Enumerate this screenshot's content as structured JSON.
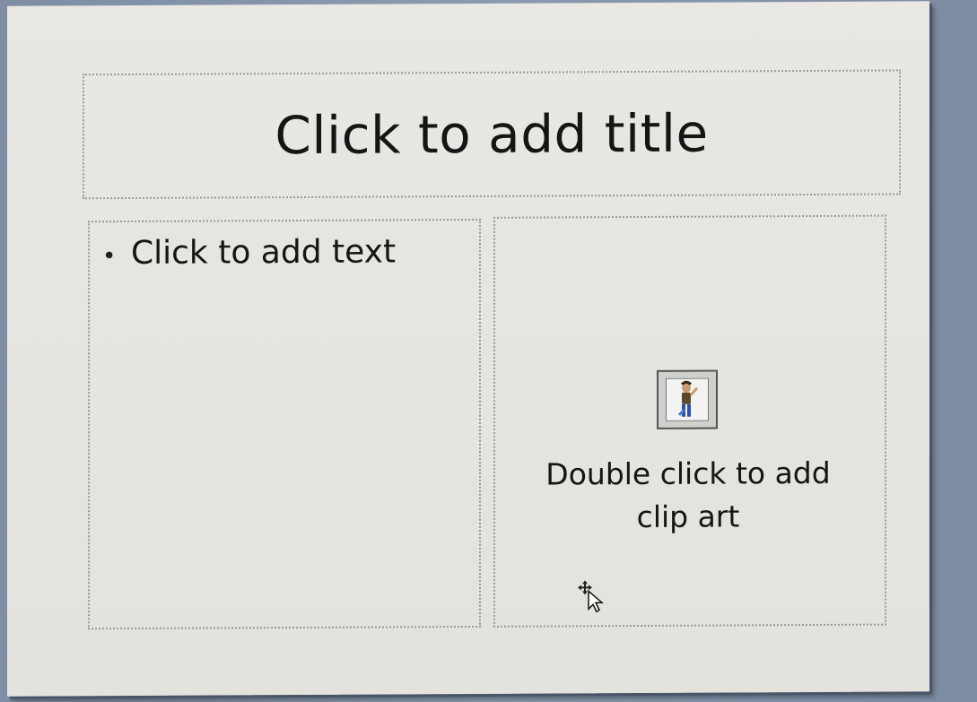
{
  "slide": {
    "title_placeholder": "Click to add title",
    "text_placeholder": "Click to add text",
    "clipart_placeholder_line1": "Double click to add",
    "clipart_placeholder_line2": "clip art"
  },
  "icons": {
    "clipart": "clip-art-icon",
    "cursor": "move-cursor-icon"
  },
  "colors": {
    "slide_background": "#e7e6e1",
    "placeholder_border": "#9a9a96",
    "text": "#151515"
  }
}
